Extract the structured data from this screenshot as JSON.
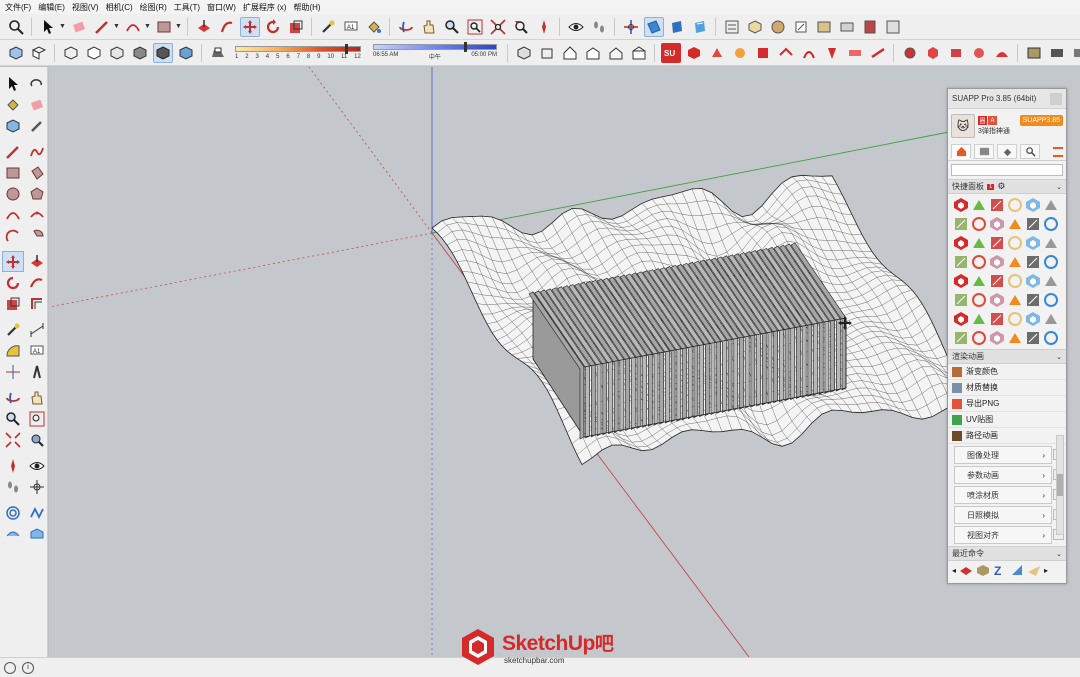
{
  "menu": [
    "文件(F)",
    "编辑(E)",
    "视图(V)",
    "相机(C)",
    "绘图(R)",
    "工具(T)",
    "窗口(W)",
    "扩展程序 (x)",
    "帮助(H)"
  ],
  "shadow": {
    "month_ticks": [
      "1",
      "2",
      "3",
      "4",
      "5",
      "6",
      "7",
      "8",
      "9",
      "10",
      "11",
      "12"
    ],
    "time_start": "06:55 AM",
    "time_mid": "中午",
    "time_end": "05:00 PM",
    "month_fraction": 0.88,
    "time_fraction": 0.74
  },
  "colors": {
    "accent_red": "#d52a2a",
    "suapp_orange": "#f28b1b",
    "axis_red": "#c23a3a",
    "axis_green": "#3f9f3f",
    "axis_blue": "#5566cc"
  },
  "suapp": {
    "title": "SUAPP Pro 3.85 (64bit)",
    "user_name": "3弹指神通",
    "version_badge": "SUAPP3.85",
    "badges": [
      "圈",
      "A"
    ],
    "quick_panel_label": "快捷面板",
    "quick_panel_count": "1",
    "render_anim_label": "渲染动画",
    "plugins": [
      "渐变颜色",
      "材质替换",
      "导出PNG",
      "UV贴图",
      "路径动画"
    ],
    "plugin_icons": [
      "palette-icon",
      "material-swap-icon",
      "export-png-icon",
      "uv-map-icon",
      "path-animation-icon"
    ],
    "categories": [
      "图像处理",
      "参数动画",
      "喷涂材质",
      "日照模拟",
      "视图对齐"
    ],
    "recent_label": "最近命令"
  },
  "watermark": {
    "brand": "SketchUp",
    "brand_suffix": "吧",
    "site": "sketchupbar.com"
  },
  "status": {
    "info_icon": "i"
  }
}
